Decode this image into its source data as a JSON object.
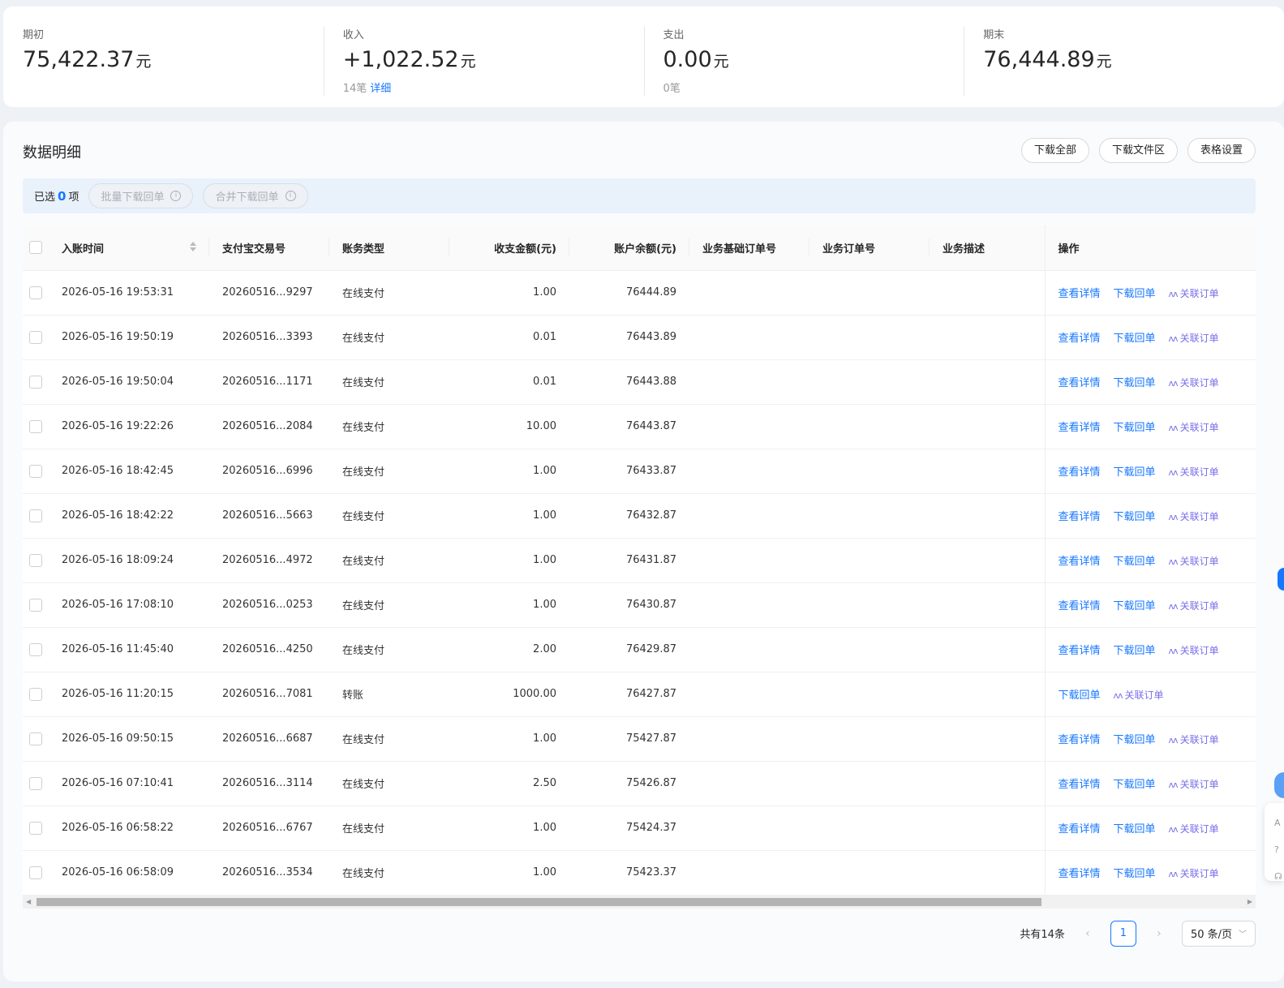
{
  "summary": [
    {
      "label": "期初",
      "value": "75,422.37",
      "unit": "元",
      "count": "",
      "link": ""
    },
    {
      "label": "收入",
      "value": "+1,022.52",
      "unit": "元",
      "count": "14笔",
      "link": "详细"
    },
    {
      "label": "支出",
      "value": "0.00",
      "unit": "元",
      "count": "0笔",
      "link": ""
    },
    {
      "label": "期末",
      "value": "76,444.89",
      "unit": "元",
      "count": "",
      "link": ""
    }
  ],
  "panel": {
    "title": "数据明细",
    "buttons": [
      "下载全部",
      "下载文件区",
      "表格设置"
    ]
  },
  "selection": {
    "prefix": "已选",
    "count": "0",
    "suffix": "项",
    "batch_download": "批量下载回单",
    "merge_download": "合并下载回单"
  },
  "table": {
    "columns": [
      "入账时间",
      "支付宝交易号",
      "账务类型",
      "收支金额(元)",
      "账户余额(元)",
      "业务基础订单号",
      "业务订单号",
      "业务描述",
      "操作"
    ],
    "actions": {
      "detail": "查看详情",
      "download": "下载回单",
      "link_order": "关联订单",
      "ai_glyph": "ʌʌ"
    },
    "rows": [
      {
        "time": "2026-05-16 19:53:31",
        "trade_no": "20260516...9297",
        "type": "在线支付",
        "amount": "1.00",
        "balance": "76444.89",
        "has_detail": true
      },
      {
        "time": "2026-05-16 19:50:19",
        "trade_no": "20260516...3393",
        "type": "在线支付",
        "amount": "0.01",
        "balance": "76443.89",
        "has_detail": true
      },
      {
        "time": "2026-05-16 19:50:04",
        "trade_no": "20260516...1171",
        "type": "在线支付",
        "amount": "0.01",
        "balance": "76443.88",
        "has_detail": true
      },
      {
        "time": "2026-05-16 19:22:26",
        "trade_no": "20260516...2084",
        "type": "在线支付",
        "amount": "10.00",
        "balance": "76443.87",
        "has_detail": true
      },
      {
        "time": "2026-05-16 18:42:45",
        "trade_no": "20260516...6996",
        "type": "在线支付",
        "amount": "1.00",
        "balance": "76433.87",
        "has_detail": true
      },
      {
        "time": "2026-05-16 18:42:22",
        "trade_no": "20260516...5663",
        "type": "在线支付",
        "amount": "1.00",
        "balance": "76432.87",
        "has_detail": true
      },
      {
        "time": "2026-05-16 18:09:24",
        "trade_no": "20260516...4972",
        "type": "在线支付",
        "amount": "1.00",
        "balance": "76431.87",
        "has_detail": true
      },
      {
        "time": "2026-05-16 17:08:10",
        "trade_no": "20260516...0253",
        "type": "在线支付",
        "amount": "1.00",
        "balance": "76430.87",
        "has_detail": true
      },
      {
        "time": "2026-05-16 11:45:40",
        "trade_no": "20260516...4250",
        "type": "在线支付",
        "amount": "2.00",
        "balance": "76429.87",
        "has_detail": true
      },
      {
        "time": "2026-05-16 11:20:15",
        "trade_no": "20260516...7081",
        "type": "转账",
        "amount": "1000.00",
        "balance": "76427.87",
        "has_detail": false
      },
      {
        "time": "2026-05-16 09:50:15",
        "trade_no": "20260516...6687",
        "type": "在线支付",
        "amount": "1.00",
        "balance": "75427.87",
        "has_detail": true
      },
      {
        "time": "2026-05-16 07:10:41",
        "trade_no": "20260516...3114",
        "type": "在线支付",
        "amount": "2.50",
        "balance": "75426.87",
        "has_detail": true
      },
      {
        "time": "2026-05-16 06:58:22",
        "trade_no": "20260516...6767",
        "type": "在线支付",
        "amount": "1.00",
        "balance": "75424.37",
        "has_detail": true
      },
      {
        "time": "2026-05-16 06:58:09",
        "trade_no": "20260516...3534",
        "type": "在线支付",
        "amount": "1.00",
        "balance": "75423.37",
        "has_detail": true
      }
    ]
  },
  "pagination": {
    "total": "共有14条",
    "current_page": "1",
    "page_size": "50 条/页"
  },
  "colors": {
    "accent": "#1677ff",
    "ai_link": "#7a6fe8"
  }
}
